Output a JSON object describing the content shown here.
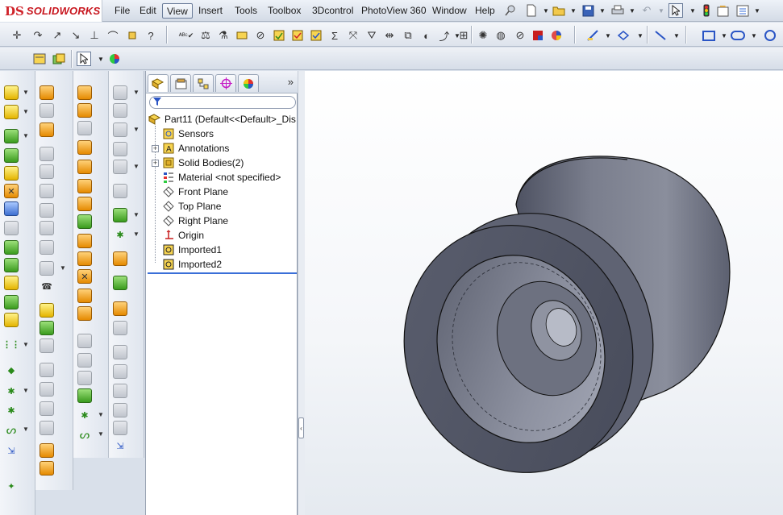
{
  "app": {
    "logo_mark": "DS",
    "logo_text": "SOLIDWORKS"
  },
  "menu": [
    {
      "label": "File",
      "active": false
    },
    {
      "label": "Edit",
      "active": false
    },
    {
      "label": "View",
      "active": true
    },
    {
      "label": "Insert",
      "active": false
    },
    {
      "label": "Tools",
      "active": false
    },
    {
      "label": "Toolbox",
      "active": false
    },
    {
      "label": "3Dcontrol",
      "active": false
    },
    {
      "label": "PhotoView 360",
      "active": false
    },
    {
      "label": "Window",
      "active": false
    },
    {
      "label": "Help",
      "active": false
    }
  ],
  "menu_tools": [
    "pin-icon",
    "new-document-icon",
    "open-icon",
    "save-icon",
    "print-icon",
    "undo-icon",
    "select-icon",
    "rebuild-icon",
    "file-properties-icon",
    "options-icon"
  ],
  "feature_tree": {
    "filter_placeholder": "",
    "tabs": [
      "featuremanager-tab",
      "propertymanager-tab",
      "configurationmanager-tab",
      "dimxpert-tab",
      "display-manager-tab"
    ],
    "root": "Part11  (Default<<Default>_Dis",
    "items": [
      {
        "label": "Sensors",
        "icon": "sensors-icon",
        "expandable": false
      },
      {
        "label": "Annotations",
        "icon": "annotations-icon",
        "expandable": true
      },
      {
        "label": "Solid Bodies(2)",
        "icon": "solid-bodies-icon",
        "expandable": true
      },
      {
        "label": "Material <not specified>",
        "icon": "material-icon",
        "expandable": false
      },
      {
        "label": "Front Plane",
        "icon": "plane-icon",
        "expandable": false
      },
      {
        "label": "Top Plane",
        "icon": "plane-icon",
        "expandable": false
      },
      {
        "label": "Right Plane",
        "icon": "plane-icon",
        "expandable": false
      },
      {
        "label": "Origin",
        "icon": "origin-icon",
        "expandable": false
      },
      {
        "label": "Imported1",
        "icon": "imported-body-icon",
        "expandable": false
      },
      {
        "label": "Imported2",
        "icon": "imported-body-icon",
        "expandable": false
      }
    ]
  },
  "colors": {
    "brand_red": "#c8161e",
    "rollback_bar": "#3a6fd8",
    "model_gray": "#6e7282"
  }
}
